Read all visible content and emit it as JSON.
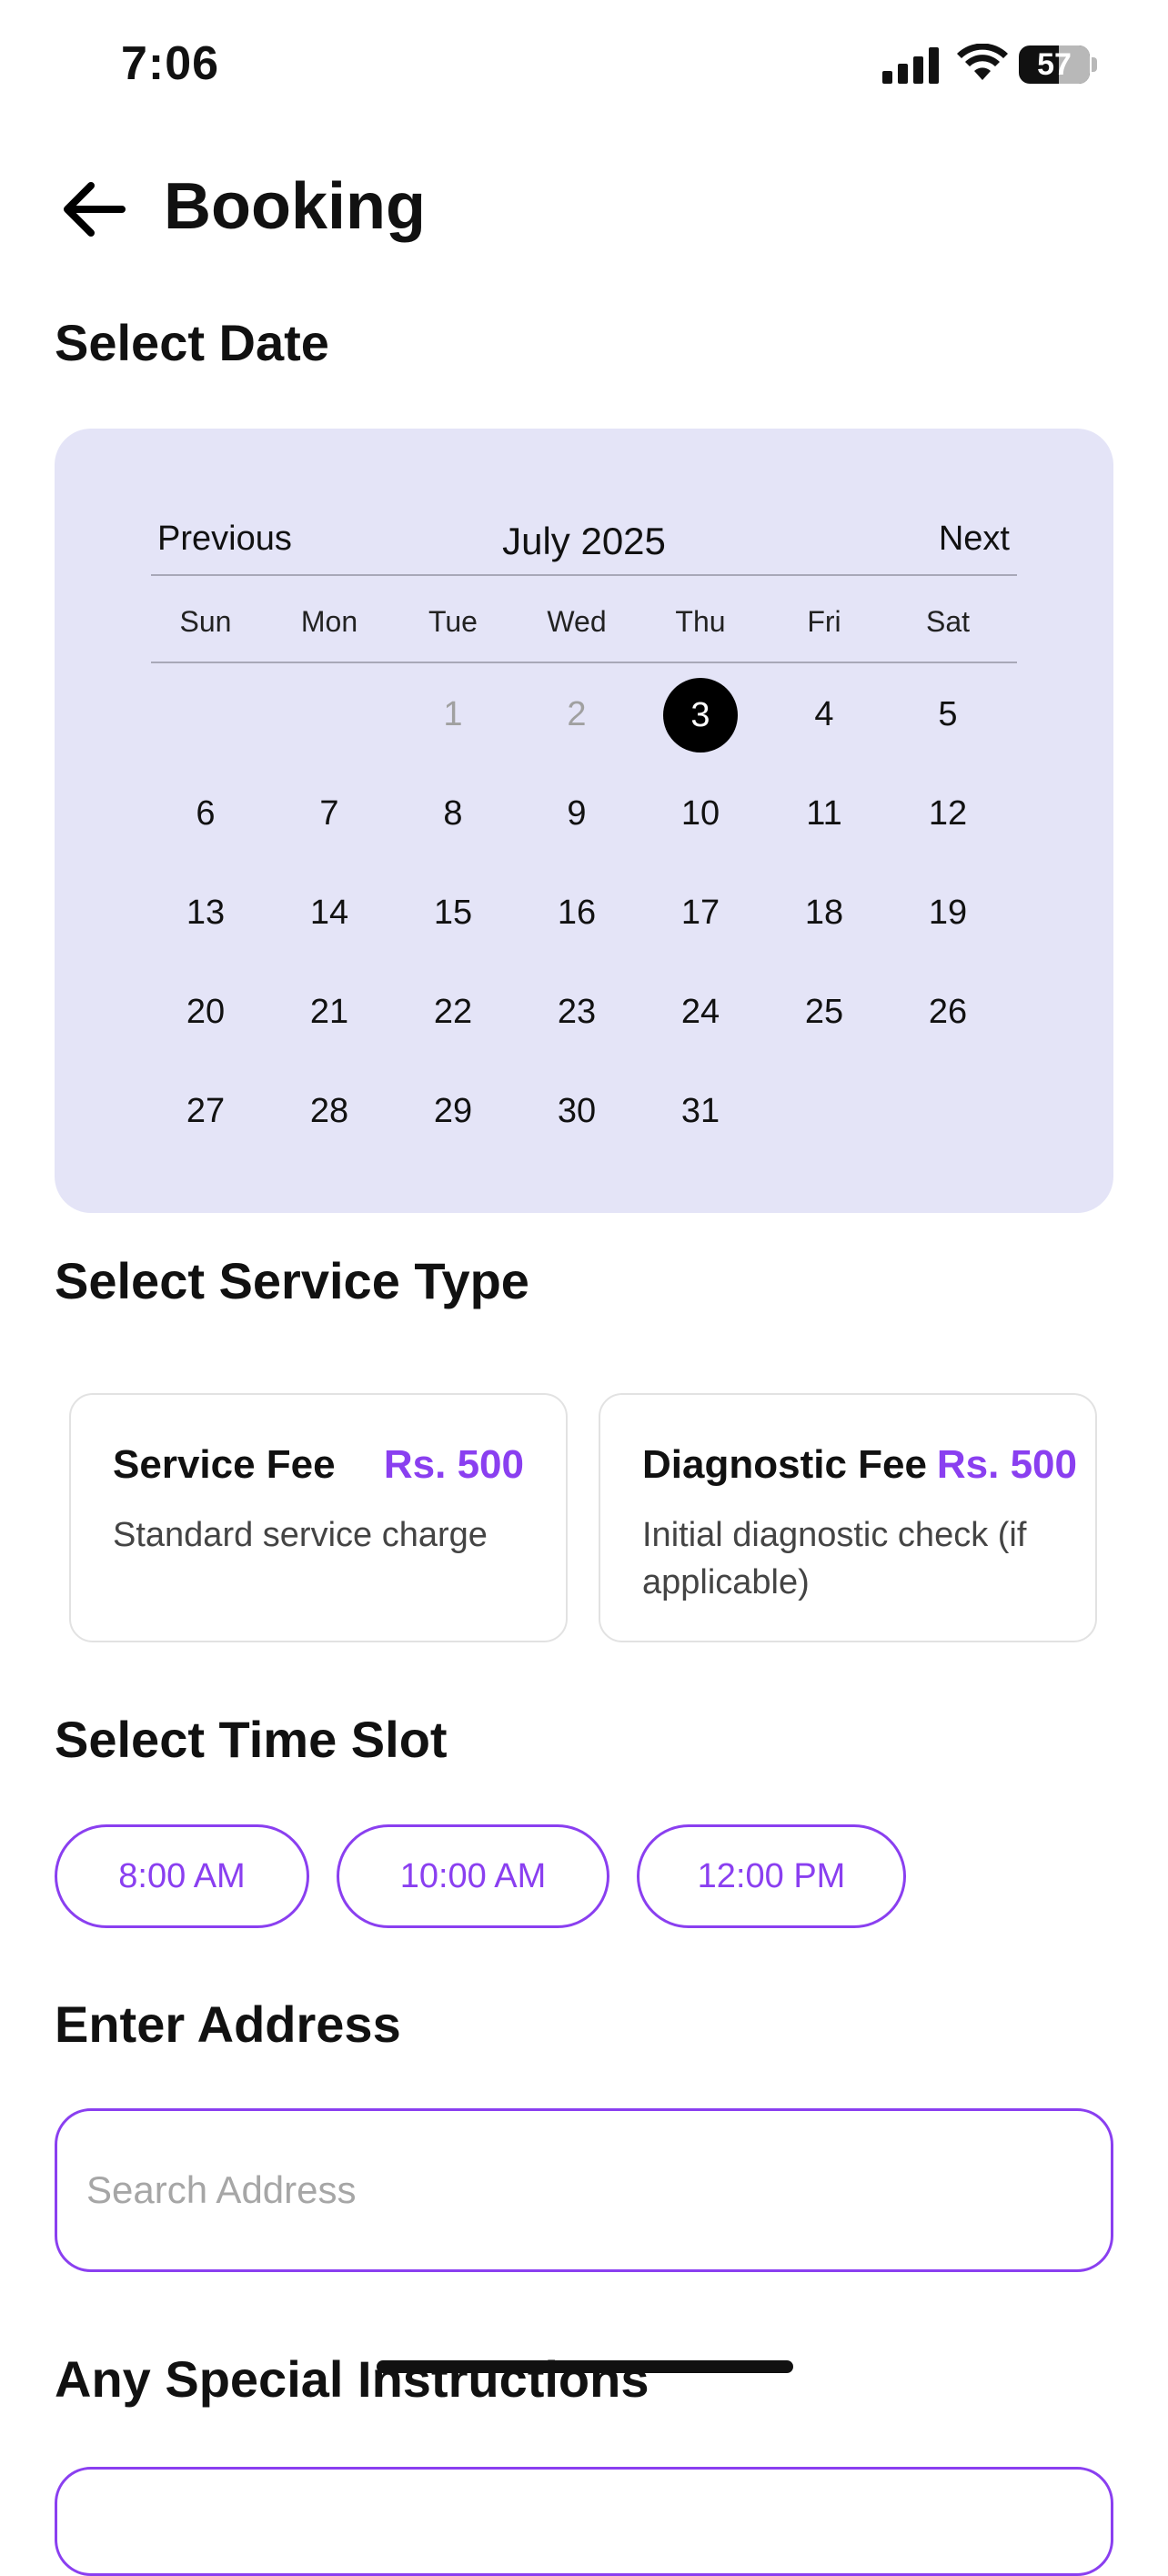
{
  "status_bar": {
    "time": "7:06",
    "battery": "57"
  },
  "header": {
    "title": "Booking"
  },
  "sections": {
    "date": "Select Date",
    "service": "Select Service Type",
    "time": "Select Time Slot",
    "address": "Enter Address",
    "instructions": "Any Special Instructions"
  },
  "calendar": {
    "prev_label": "Previous",
    "next_label": "Next",
    "month": "July",
    "year": "2025",
    "weekdays": [
      "Sun",
      "Mon",
      "Tue",
      "Wed",
      "Thu",
      "Fri",
      "Sat"
    ],
    "selected_day": "3",
    "disabled_days": [
      "1",
      "2"
    ],
    "days": [
      "1",
      "2",
      "3",
      "4",
      "5",
      "6",
      "7",
      "8",
      "9",
      "10",
      "11",
      "12",
      "13",
      "14",
      "15",
      "16",
      "17",
      "18",
      "19",
      "20",
      "21",
      "22",
      "23",
      "24",
      "25",
      "26",
      "27",
      "28",
      "29",
      "30",
      "31"
    ]
  },
  "services": [
    {
      "title": "Service Fee",
      "price": "Rs. 500",
      "desc": "Standard service charge"
    },
    {
      "title": "Diagnostic Fee",
      "price": "Rs. 500",
      "desc": "Initial diagnostic check (if applicable)"
    }
  ],
  "time_slots": [
    "8:00 AM",
    "10:00 AM",
    "12:00 PM"
  ],
  "address": {
    "placeholder": "Search Address",
    "value": ""
  },
  "colors": {
    "accent": "#8a3ff0",
    "calendar_bg": "#e4e4f7",
    "selected": "#000000"
  }
}
